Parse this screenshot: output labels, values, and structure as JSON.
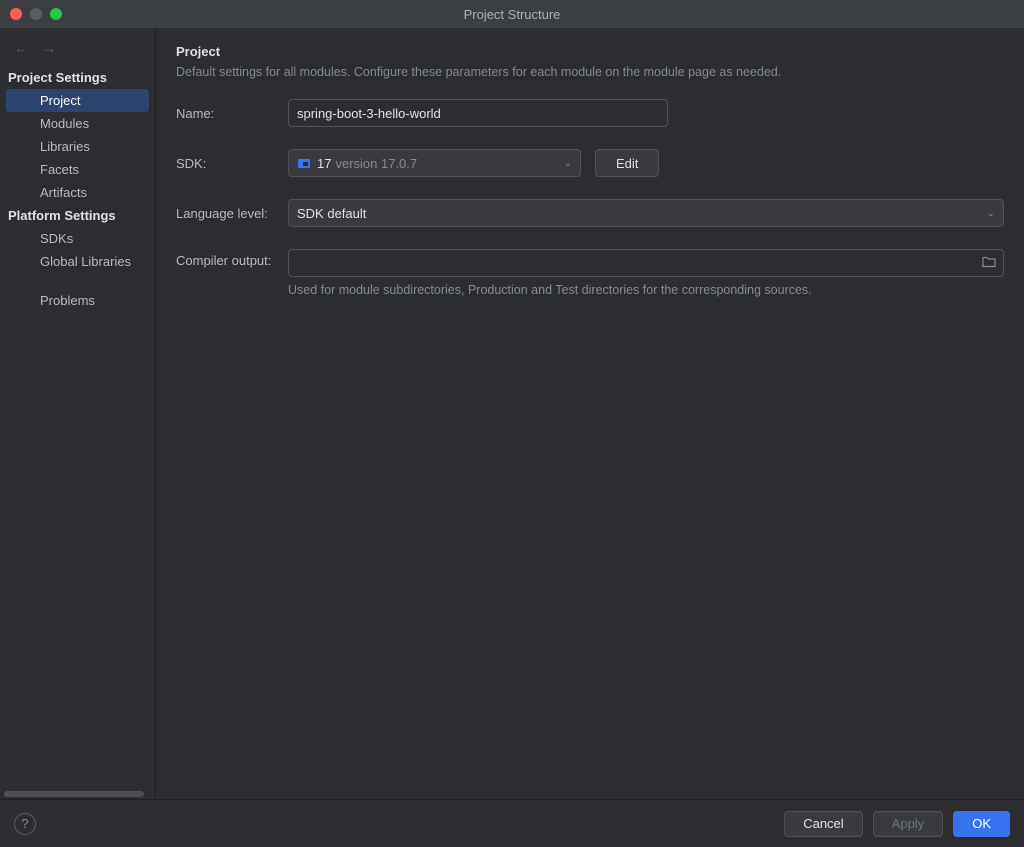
{
  "window": {
    "title": "Project Structure"
  },
  "sidebar": {
    "section1_title": "Project Settings",
    "section1_items": [
      "Project",
      "Modules",
      "Libraries",
      "Facets",
      "Artifacts"
    ],
    "section2_title": "Platform Settings",
    "section2_items": [
      "SDKs",
      "Global Libraries"
    ],
    "problems_label": "Problems"
  },
  "content": {
    "title": "Project",
    "description": "Default settings for all modules. Configure these parameters for each module on the module page as needed.",
    "name_label": "Name:",
    "name_value": "spring-boot-3-hello-world",
    "sdk_label": "SDK:",
    "sdk_number": "17",
    "sdk_version": "version 17.0.7",
    "edit_label": "Edit",
    "lang_label": "Language level:",
    "lang_value": "SDK default",
    "compiler_label": "Compiler output:",
    "compiler_value": "",
    "compiler_hint": "Used for module subdirectories, Production and Test directories for the corresponding sources."
  },
  "footer": {
    "cancel": "Cancel",
    "apply": "Apply",
    "ok": "OK"
  }
}
